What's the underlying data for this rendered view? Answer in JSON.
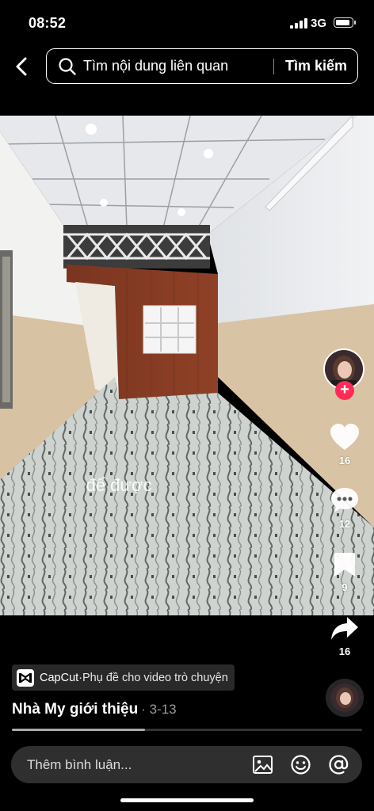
{
  "status_bar": {
    "time": "08:52",
    "network": "3G",
    "battery_level": 0.9
  },
  "search": {
    "placeholder": "Tìm nội dung liên quan",
    "submit_label": "Tìm kiếm"
  },
  "video": {
    "caption_text": "để được ",
    "playback_progress": 0.38
  },
  "actions": {
    "likes": "16",
    "comments": "12",
    "saves": "9",
    "shares": "16"
  },
  "capcut": {
    "brand": "CapCut",
    "separator": " · ",
    "description": "Phụ đề cho video trò chuyện"
  },
  "post": {
    "author": "Nhà My giới thiệu",
    "date": "· 3-13"
  },
  "comment": {
    "placeholder": "Thêm bình luận..."
  },
  "colors": {
    "accent": "#fe2c55",
    "background": "#000000",
    "input_bg": "#2f2f2f"
  },
  "icons": [
    "back-chevron-icon",
    "search-icon",
    "heart-icon",
    "comment-bubble-icon",
    "bookmark-icon",
    "share-arrow-icon",
    "capcut-logo-icon",
    "image-icon",
    "emoji-icon",
    "mention-icon"
  ]
}
